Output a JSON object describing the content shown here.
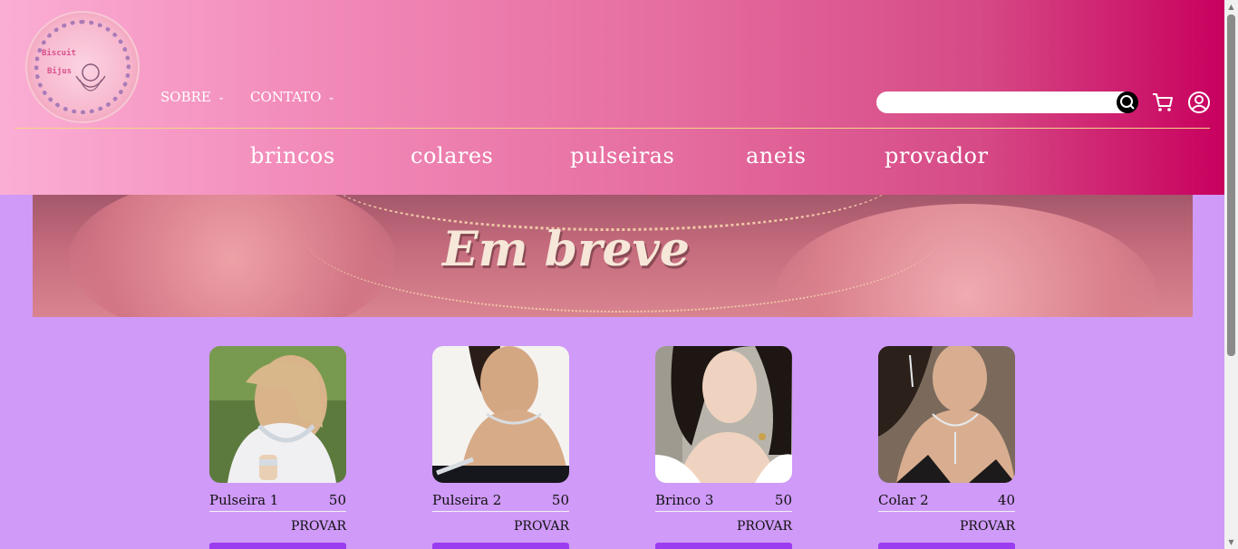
{
  "header": {
    "logo_line1": "Biscuit",
    "logo_line2": "Bijus",
    "nav": [
      {
        "label": "SOBRE",
        "chevron": "⌄"
      },
      {
        "label": "CONTATO",
        "chevron": "⌄"
      }
    ],
    "search": {
      "value": "",
      "placeholder": ""
    },
    "icons": {
      "search": "search-icon",
      "cart": "cart-icon",
      "account": "user-circle-icon"
    },
    "categories": [
      "brincos",
      "colares",
      "pulseiras",
      "aneis",
      "provador"
    ]
  },
  "banner": {
    "text": "Em breve"
  },
  "products": [
    {
      "name": "Pulseira 1",
      "price": "50",
      "action": "PROVAR"
    },
    {
      "name": "Pulseira 2",
      "price": "50",
      "action": "PROVAR"
    },
    {
      "name": "Brinco 3",
      "price": "50",
      "action": "PROVAR"
    },
    {
      "name": "Colar 2",
      "price": "40",
      "action": "PROVAR"
    }
  ],
  "colors": {
    "page_bg": "#cf9af8",
    "header_start": "#fbaed4",
    "header_end": "#c8005e",
    "button_purple": "#9a3cf0",
    "divider_gold": "#f5d38a"
  }
}
